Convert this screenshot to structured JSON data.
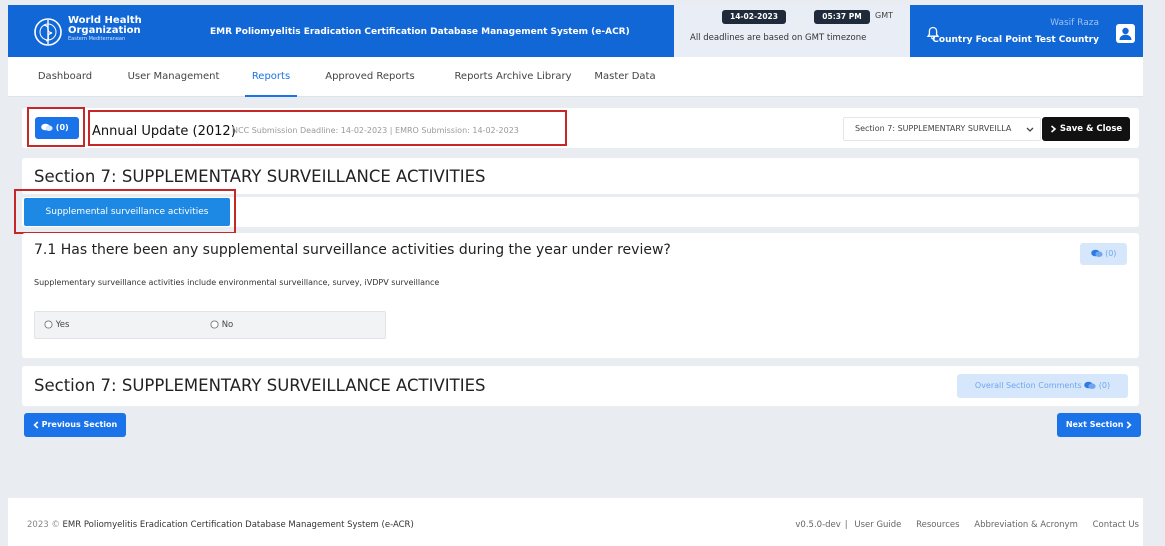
{
  "header": {
    "org_line1": "World Health",
    "org_line2": "Organization",
    "org_region": "Eastern Mediterranean",
    "app_title": "EMR Poliomyelitis Eradication Certification Database Management System (e-ACR)",
    "date": "14-02-2023",
    "time": "05:37 PM",
    "tz": "GMT",
    "deadline_note": "All deadlines are based on GMT timezone",
    "user_name": "Wasif Raza",
    "user_role": "Country Focal Point Test Country"
  },
  "nav": {
    "items": [
      {
        "label": "Dashboard"
      },
      {
        "label": "User Management"
      },
      {
        "label": "Reports"
      },
      {
        "label": "Approved Reports"
      },
      {
        "label": "Reports Archive Library"
      },
      {
        "label": "Master Data"
      }
    ],
    "active": "Reports"
  },
  "report_bar": {
    "comments_count": "(0)",
    "title": "Annual Update (2012)",
    "deadlines": "NCC Submission Deadline: 14-02-2023 | EMRO Submission: 14-02-2023",
    "section_select": "Section 7: SUPPLEMENTARY SURVEILLA",
    "save_close": "Save & Close"
  },
  "section": {
    "title": "Section 7: SUPPLEMENTARY SURVEILLANCE ACTIVITIES",
    "tab_label": "Supplemental surveillance activities",
    "question": "7.1 Has there been any supplemental surveillance activities during the year under review?",
    "question_comments": "(0)",
    "note": "Supplementary surveillance activities include environmental surveillance, survey, iVDPV surveillance",
    "options": [
      "Yes",
      "No"
    ],
    "footer_title": "Section 7: SUPPLEMENTARY SURVEILLANCE ACTIVITIES",
    "overall_comments": "Overall Section Comments",
    "overall_count": "(0)"
  },
  "pager": {
    "previous": "Previous Section",
    "next": "Next Section"
  },
  "footer": {
    "year": "2023 ©",
    "app": "EMR Poliomyelitis Eradication Certification Database Management System (e-ACR)",
    "links": [
      "v0.5.0-dev",
      "User Guide",
      "Resources",
      "Abbreviation & Acronym",
      "Contact Us"
    ]
  },
  "colors": {
    "brand_blue": "#1267d6",
    "accent": "#1a73e8",
    "highlight_red": "#c62828"
  },
  "icons": [
    "who-logo-icon",
    "bell-icon",
    "user-avatar-icon",
    "comment-icon",
    "chevron-down-icon",
    "chevron-right-icon",
    "chevron-left-icon",
    "radio-icon"
  ]
}
